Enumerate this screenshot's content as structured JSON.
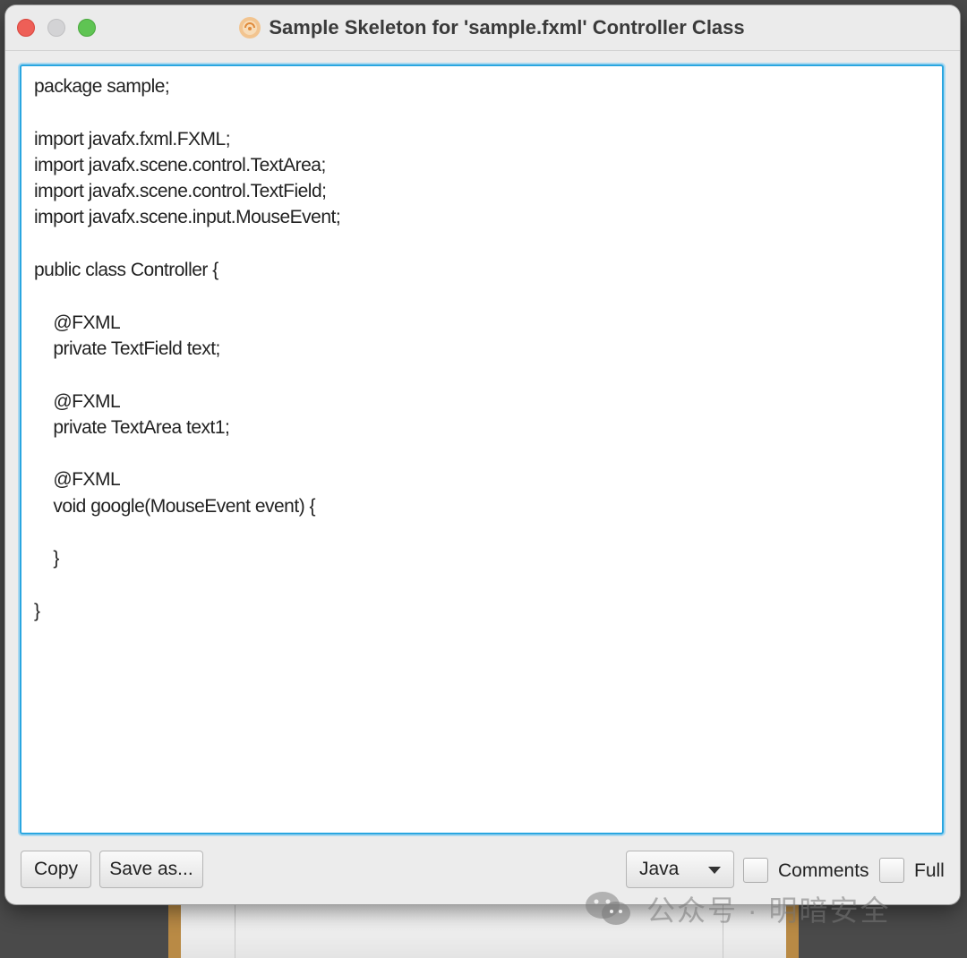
{
  "window": {
    "title": "Sample Skeleton for 'sample.fxml' Controller Class"
  },
  "editor": {
    "code": "package sample;\n\nimport javafx.fxml.FXML;\nimport javafx.scene.control.TextArea;\nimport javafx.scene.control.TextField;\nimport javafx.scene.input.MouseEvent;\n\npublic class Controller {\n\n    @FXML\n    private TextField text;\n\n    @FXML\n    private TextArea text1;\n\n    @FXML\n    void google(MouseEvent event) {\n\n    }\n\n}"
  },
  "toolbar": {
    "copy_label": "Copy",
    "save_label": "Save as...",
    "language_selected": "Java",
    "comments_label": "Comments",
    "comments_checked": false,
    "full_label": "Full",
    "full_checked": false
  },
  "watermark": {
    "text": "公众号 · 明暗安全"
  },
  "colors": {
    "accent_focus": "#2aa6e0",
    "close": "#ee5f57",
    "minimize": "#d3d3d5",
    "maximize": "#5fc453"
  },
  "icons": {
    "app": "scene-builder-icon",
    "watermark": "wechat-icon",
    "dropdown": "chevron-down-icon"
  }
}
